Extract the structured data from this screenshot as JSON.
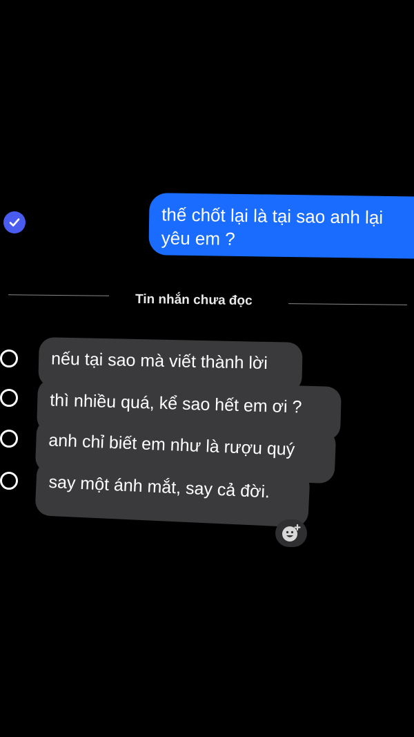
{
  "sent_message": {
    "line1": "thế chốt lại là tại sao anh lại",
    "line2": "yêu em ?",
    "bubble_color": "#1a6cff",
    "status_icon": "check-circle-icon"
  },
  "unread_divider": {
    "label": "Tin nhắn chưa đọc"
  },
  "received_messages": [
    {
      "text": "nếu tại sao mà viết thành lời"
    },
    {
      "text": "thì nhiều quá, kể sao hết em ơi ?"
    },
    {
      "text": "anh chỉ biết em như là rượu quý"
    },
    {
      "text": "say một ánh mắt, say cả đời."
    }
  ],
  "reaction_button": {
    "icon": "add-reaction-icon"
  },
  "colors": {
    "background": "#000000",
    "received_bubble": "#3a3a3c",
    "check_badge": "#4a5cf0"
  }
}
